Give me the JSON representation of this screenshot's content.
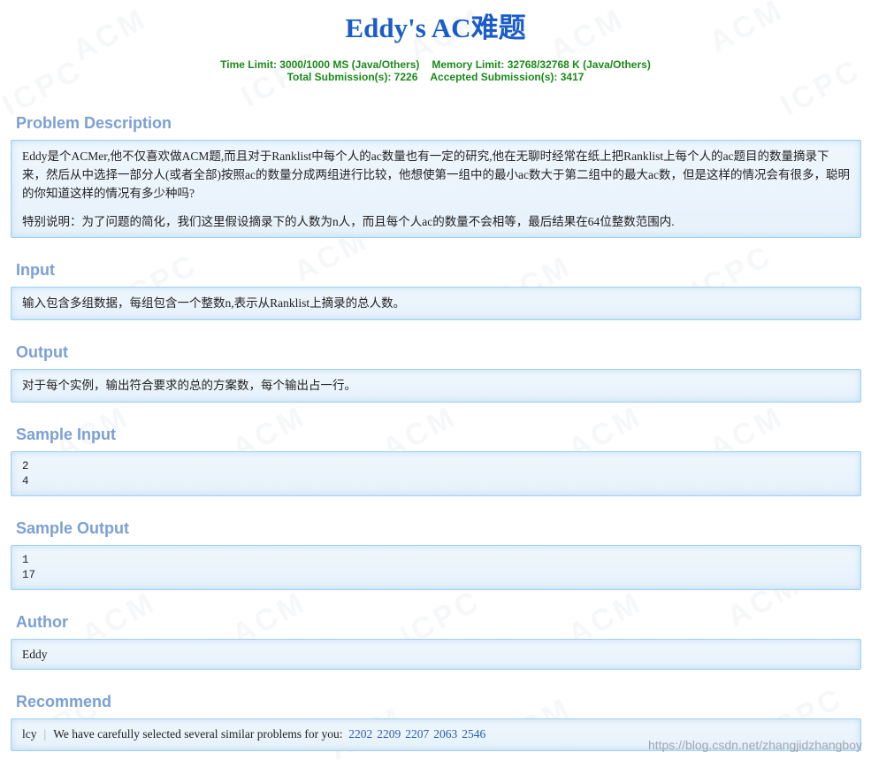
{
  "problem": {
    "title": "Eddy's AC难题",
    "time_limit": "Time Limit: 3000/1000 MS (Java/Others)",
    "memory_limit": "Memory Limit: 32768/32768 K (Java/Others)",
    "total_submissions": "Total Submission(s): 7226",
    "accepted_submissions": "Accepted Submission(s): 3417"
  },
  "sections": {
    "description": {
      "heading": "Problem Description",
      "para1": "Eddy是个ACMer,他不仅喜欢做ACM题,而且对于Ranklist中每个人的ac数量也有一定的研究,他在无聊时经常在纸上把Ranklist上每个人的ac题目的数量摘录下来，然后从中选择一部分人(或者全部)按照ac的数量分成两组进行比较，他想使第一组中的最小ac数大于第二组中的最大ac数，但是这样的情况会有很多，聪明的你知道这样的情况有多少种吗?",
      "para2": "特别说明：为了问题的简化，我们这里假设摘录下的人数为n人，而且每个人ac的数量不会相等，最后结果在64位整数范围内."
    },
    "input": {
      "heading": "Input",
      "text": "输入包含多组数据，每组包含一个整数n,表示从Ranklist上摘录的总人数。"
    },
    "output": {
      "heading": "Output",
      "text": "对于每个实例，输出符合要求的总的方案数，每个输出占一行。"
    },
    "sample_input": {
      "heading": "Sample Input",
      "lines": [
        "2",
        "4"
      ]
    },
    "sample_output": {
      "heading": "Sample Output",
      "lines": [
        "1",
        "17"
      ]
    },
    "author": {
      "heading": "Author",
      "text": "Eddy"
    },
    "recommend": {
      "heading": "Recommend",
      "user": "lcy",
      "separator": "|",
      "text": "We have carefully selected several similar problems for you:",
      "problems": [
        "2202",
        "2209",
        "2207",
        "2063",
        "2546"
      ]
    }
  },
  "watermark_url": "https://blog.csdn.net/zhangjidzhangboy",
  "colors": {
    "title": "#1a5cc8",
    "limits": "#1a8a1a",
    "heading": "#7b9fd6",
    "box_border": "#9fcff0",
    "box_bg": "#e6f1fb",
    "link": "#2a5fb0"
  }
}
